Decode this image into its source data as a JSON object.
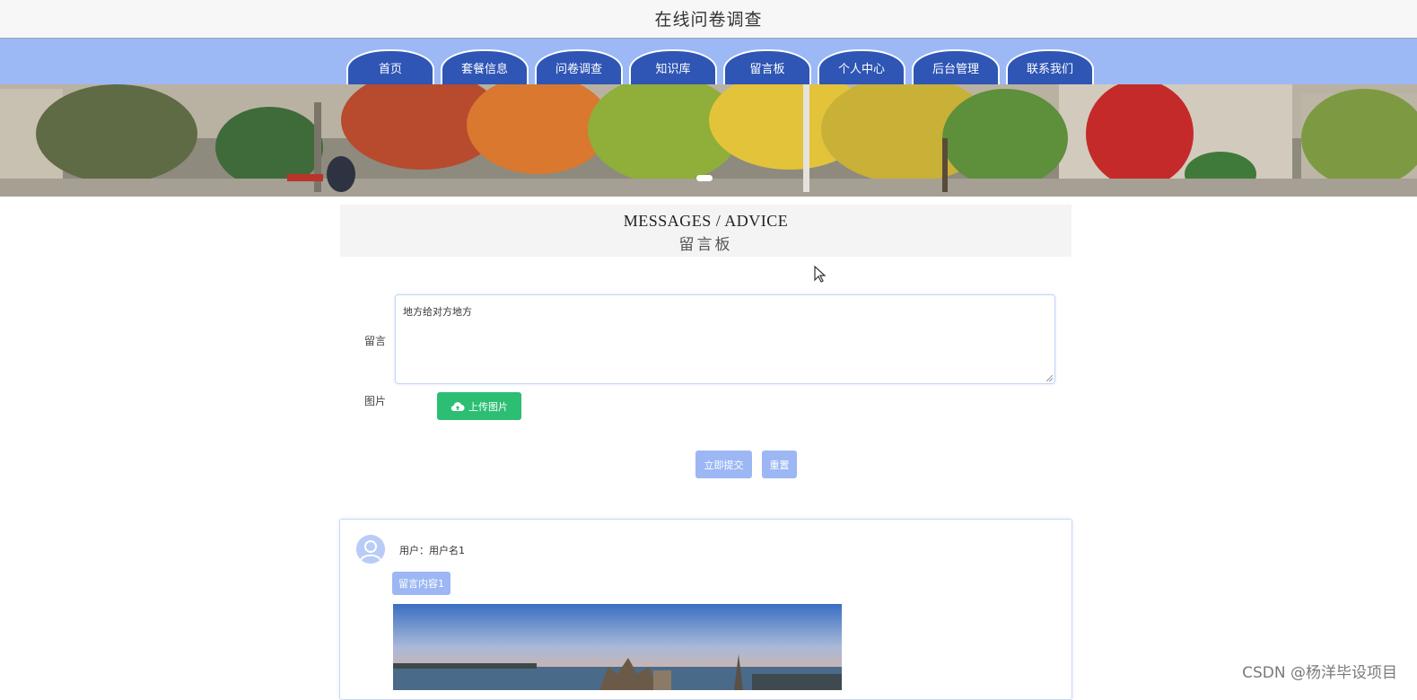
{
  "header": {
    "title": "在线问卷调查"
  },
  "nav": {
    "items": [
      {
        "label": "首页"
      },
      {
        "label": "套餐信息"
      },
      {
        "label": "问卷调查"
      },
      {
        "label": "知识库"
      },
      {
        "label": "留言板"
      },
      {
        "label": "个人中心"
      },
      {
        "label": "后台管理"
      },
      {
        "label": "联系我们"
      }
    ]
  },
  "section": {
    "title_en": "MESSAGES / ADVICE",
    "title_zh": "留言板"
  },
  "form": {
    "message_label": "留言",
    "message_value": "地方给对方地方",
    "image_label": "图片",
    "upload_label": "上传图片",
    "submit_label": "立即提交",
    "reset_label": "重置"
  },
  "messages": [
    {
      "user": "用户：用户名1",
      "content": "留言内容1"
    }
  ],
  "watermark": "CSDN @杨洋毕设项目",
  "colors": {
    "nav_bar": "#9cb9f6",
    "nav_item": "#2f56b5",
    "upload_button": "#2cbe73",
    "light_button": "#9cb7f4"
  }
}
